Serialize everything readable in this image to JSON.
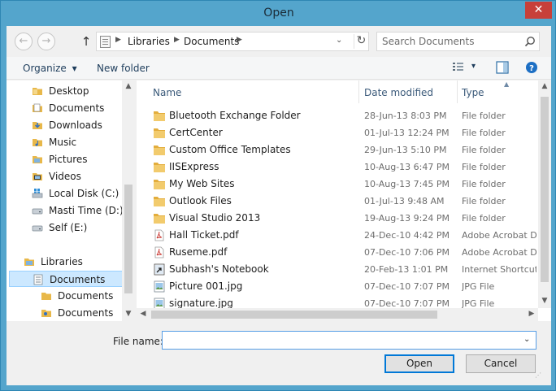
{
  "window": {
    "title": "Open",
    "close_glyph": "✕"
  },
  "nav": {
    "back_glyph": "←",
    "forward_glyph": "→",
    "up_glyph": "↑"
  },
  "address": {
    "crumbs": [
      "Libraries",
      "Documents"
    ],
    "dropdown_glyph": "⌄",
    "refresh_glyph": "↻"
  },
  "search": {
    "placeholder": "Search Documents"
  },
  "toolbar": {
    "organize_label": "Organize",
    "new_folder_label": "New folder",
    "dropdown_glyph": "▾"
  },
  "navigation_pane": {
    "items": [
      {
        "label": "Desktop",
        "icon": "folder-icon"
      },
      {
        "label": "Documents",
        "icon": "documents-folder-icon"
      },
      {
        "label": "Downloads",
        "icon": "downloads-folder-icon"
      },
      {
        "label": "Music",
        "icon": "music-folder-icon"
      },
      {
        "label": "Pictures",
        "icon": "pictures-folder-icon"
      },
      {
        "label": "Videos",
        "icon": "videos-folder-icon"
      },
      {
        "label": "Local Disk (C:)",
        "icon": "windows-drive-icon"
      },
      {
        "label": "Masti Time (D:)",
        "icon": "drive-icon"
      },
      {
        "label": "Self (E:)",
        "icon": "drive-icon"
      },
      {
        "label": "Libraries",
        "icon": "libraries-icon"
      },
      {
        "label": "Documents",
        "icon": "documents-library-icon",
        "selected": true
      },
      {
        "label": "Documents",
        "icon": "folder-icon"
      },
      {
        "label": "Documents",
        "icon": "user-folder-icon"
      }
    ]
  },
  "file_list": {
    "columns": [
      "Name",
      "Date modified",
      "Type"
    ],
    "rows": [
      {
        "name": "Bluetooth Exchange Folder",
        "date": "28-Jun-13 8:03 PM",
        "type": "File folder",
        "icon": "folder-icon"
      },
      {
        "name": "CertCenter",
        "date": "01-Jul-13 12:24 PM",
        "type": "File folder",
        "icon": "folder-icon"
      },
      {
        "name": "Custom Office Templates",
        "date": "29-Jun-13 5:10 PM",
        "type": "File folder",
        "icon": "folder-icon"
      },
      {
        "name": "IISExpress",
        "date": "10-Aug-13 6:47 PM",
        "type": "File folder",
        "icon": "folder-icon"
      },
      {
        "name": "My Web Sites",
        "date": "10-Aug-13 7:45 PM",
        "type": "File folder",
        "icon": "folder-icon"
      },
      {
        "name": "Outlook Files",
        "date": "01-Jul-13 9:48 AM",
        "type": "File folder",
        "icon": "folder-icon"
      },
      {
        "name": "Visual Studio 2013",
        "date": "19-Aug-13 9:24 PM",
        "type": "File folder",
        "icon": "folder-icon"
      },
      {
        "name": "Hall Ticket.pdf",
        "date": "24-Dec-10 4:42 PM",
        "type": "Adobe Acrobat D",
        "icon": "pdf-icon"
      },
      {
        "name": "Ruseme.pdf",
        "date": "07-Dec-10 7:06 PM",
        "type": "Adobe Acrobat D",
        "icon": "pdf-icon"
      },
      {
        "name": "Subhash's Notebook",
        "date": "20-Feb-13 1:01 PM",
        "type": "Internet Shortcut",
        "icon": "shortcut-icon"
      },
      {
        "name": "Picture 001.jpg",
        "date": "07-Dec-10 7:07 PM",
        "type": "JPG File",
        "icon": "image-icon"
      },
      {
        "name": "signature.jpg",
        "date": "07-Dec-10 7:07 PM",
        "type": "JPG File",
        "icon": "image-icon"
      }
    ]
  },
  "filename": {
    "label": "File name:",
    "value": "",
    "dropdown_glyph": "⌄"
  },
  "buttons": {
    "open_label": "Open",
    "cancel_label": "Cancel"
  },
  "colors": {
    "accent": "#0078d7",
    "selection": "#cce8ff",
    "folder": "#e8b84a",
    "title_bar": "#54a5cc",
    "close": "#c7403a"
  }
}
